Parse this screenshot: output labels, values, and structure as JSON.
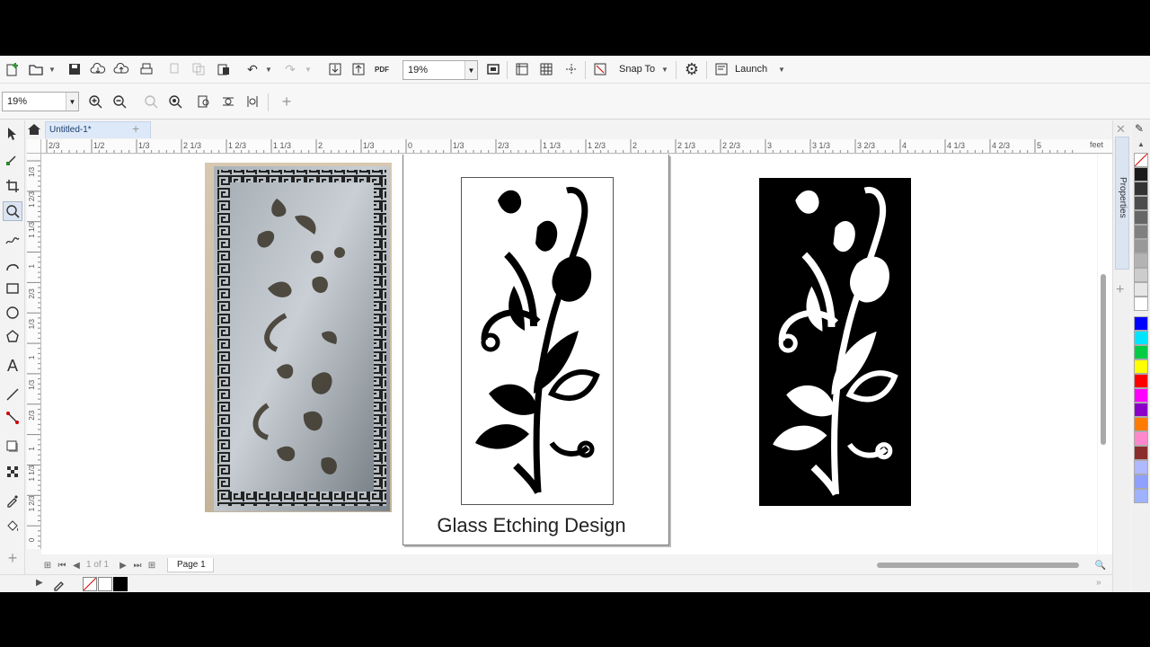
{
  "app": {
    "document_tab": "Untitled-1*",
    "page_tab": "Page 1",
    "page_nav": "1 of 1",
    "zoom_top": "19%",
    "zoom_left": "19%",
    "snap_to": "Snap To",
    "launch": "Launch",
    "ruler_unit": "feet",
    "pdf_label": "PDF",
    "docker_tab": "Properties"
  },
  "canvas": {
    "caption": "Glass Etching Design"
  },
  "ruler": {
    "h_ticks": [
      "2/3",
      "1/2",
      "1/3",
      "2 1/3",
      "1 2/3",
      "1 1/3",
      "2",
      "1/3",
      "0",
      "1/3",
      "2/3",
      "1 1/3",
      "1 2/3",
      "2",
      "2 1/3",
      "2 2/3",
      "3",
      "3 1/3",
      "3 2/3",
      "4",
      "4 1/3",
      "4 2/3",
      "5"
    ],
    "v_ticks": [
      "1/3",
      "1 2/3",
      "1 1/3",
      "1",
      "2/3",
      "1/3",
      "1",
      "1/3",
      "2/3",
      "1",
      "1 1/3",
      "1 2/3",
      "0"
    ]
  },
  "colors": {
    "palette": [
      "#ffffff",
      "#1a1a1a",
      "#333333",
      "#4d4d4d",
      "#666666",
      "#808080",
      "#999999",
      "#b3b3b3",
      "#cccccc",
      "#e6e6e6",
      "#ffffff",
      "#0000ff",
      "#00e5ff",
      "#00cc44",
      "#ffff00",
      "#ff0000",
      "#ff00ff",
      "#8a00c8",
      "#ff7a00",
      "#ff88cc",
      "#8b2d2d",
      "#b0b8ff",
      "#8fa0ff",
      "#9fb2ff"
    ],
    "accent": "#1e5aa8"
  }
}
